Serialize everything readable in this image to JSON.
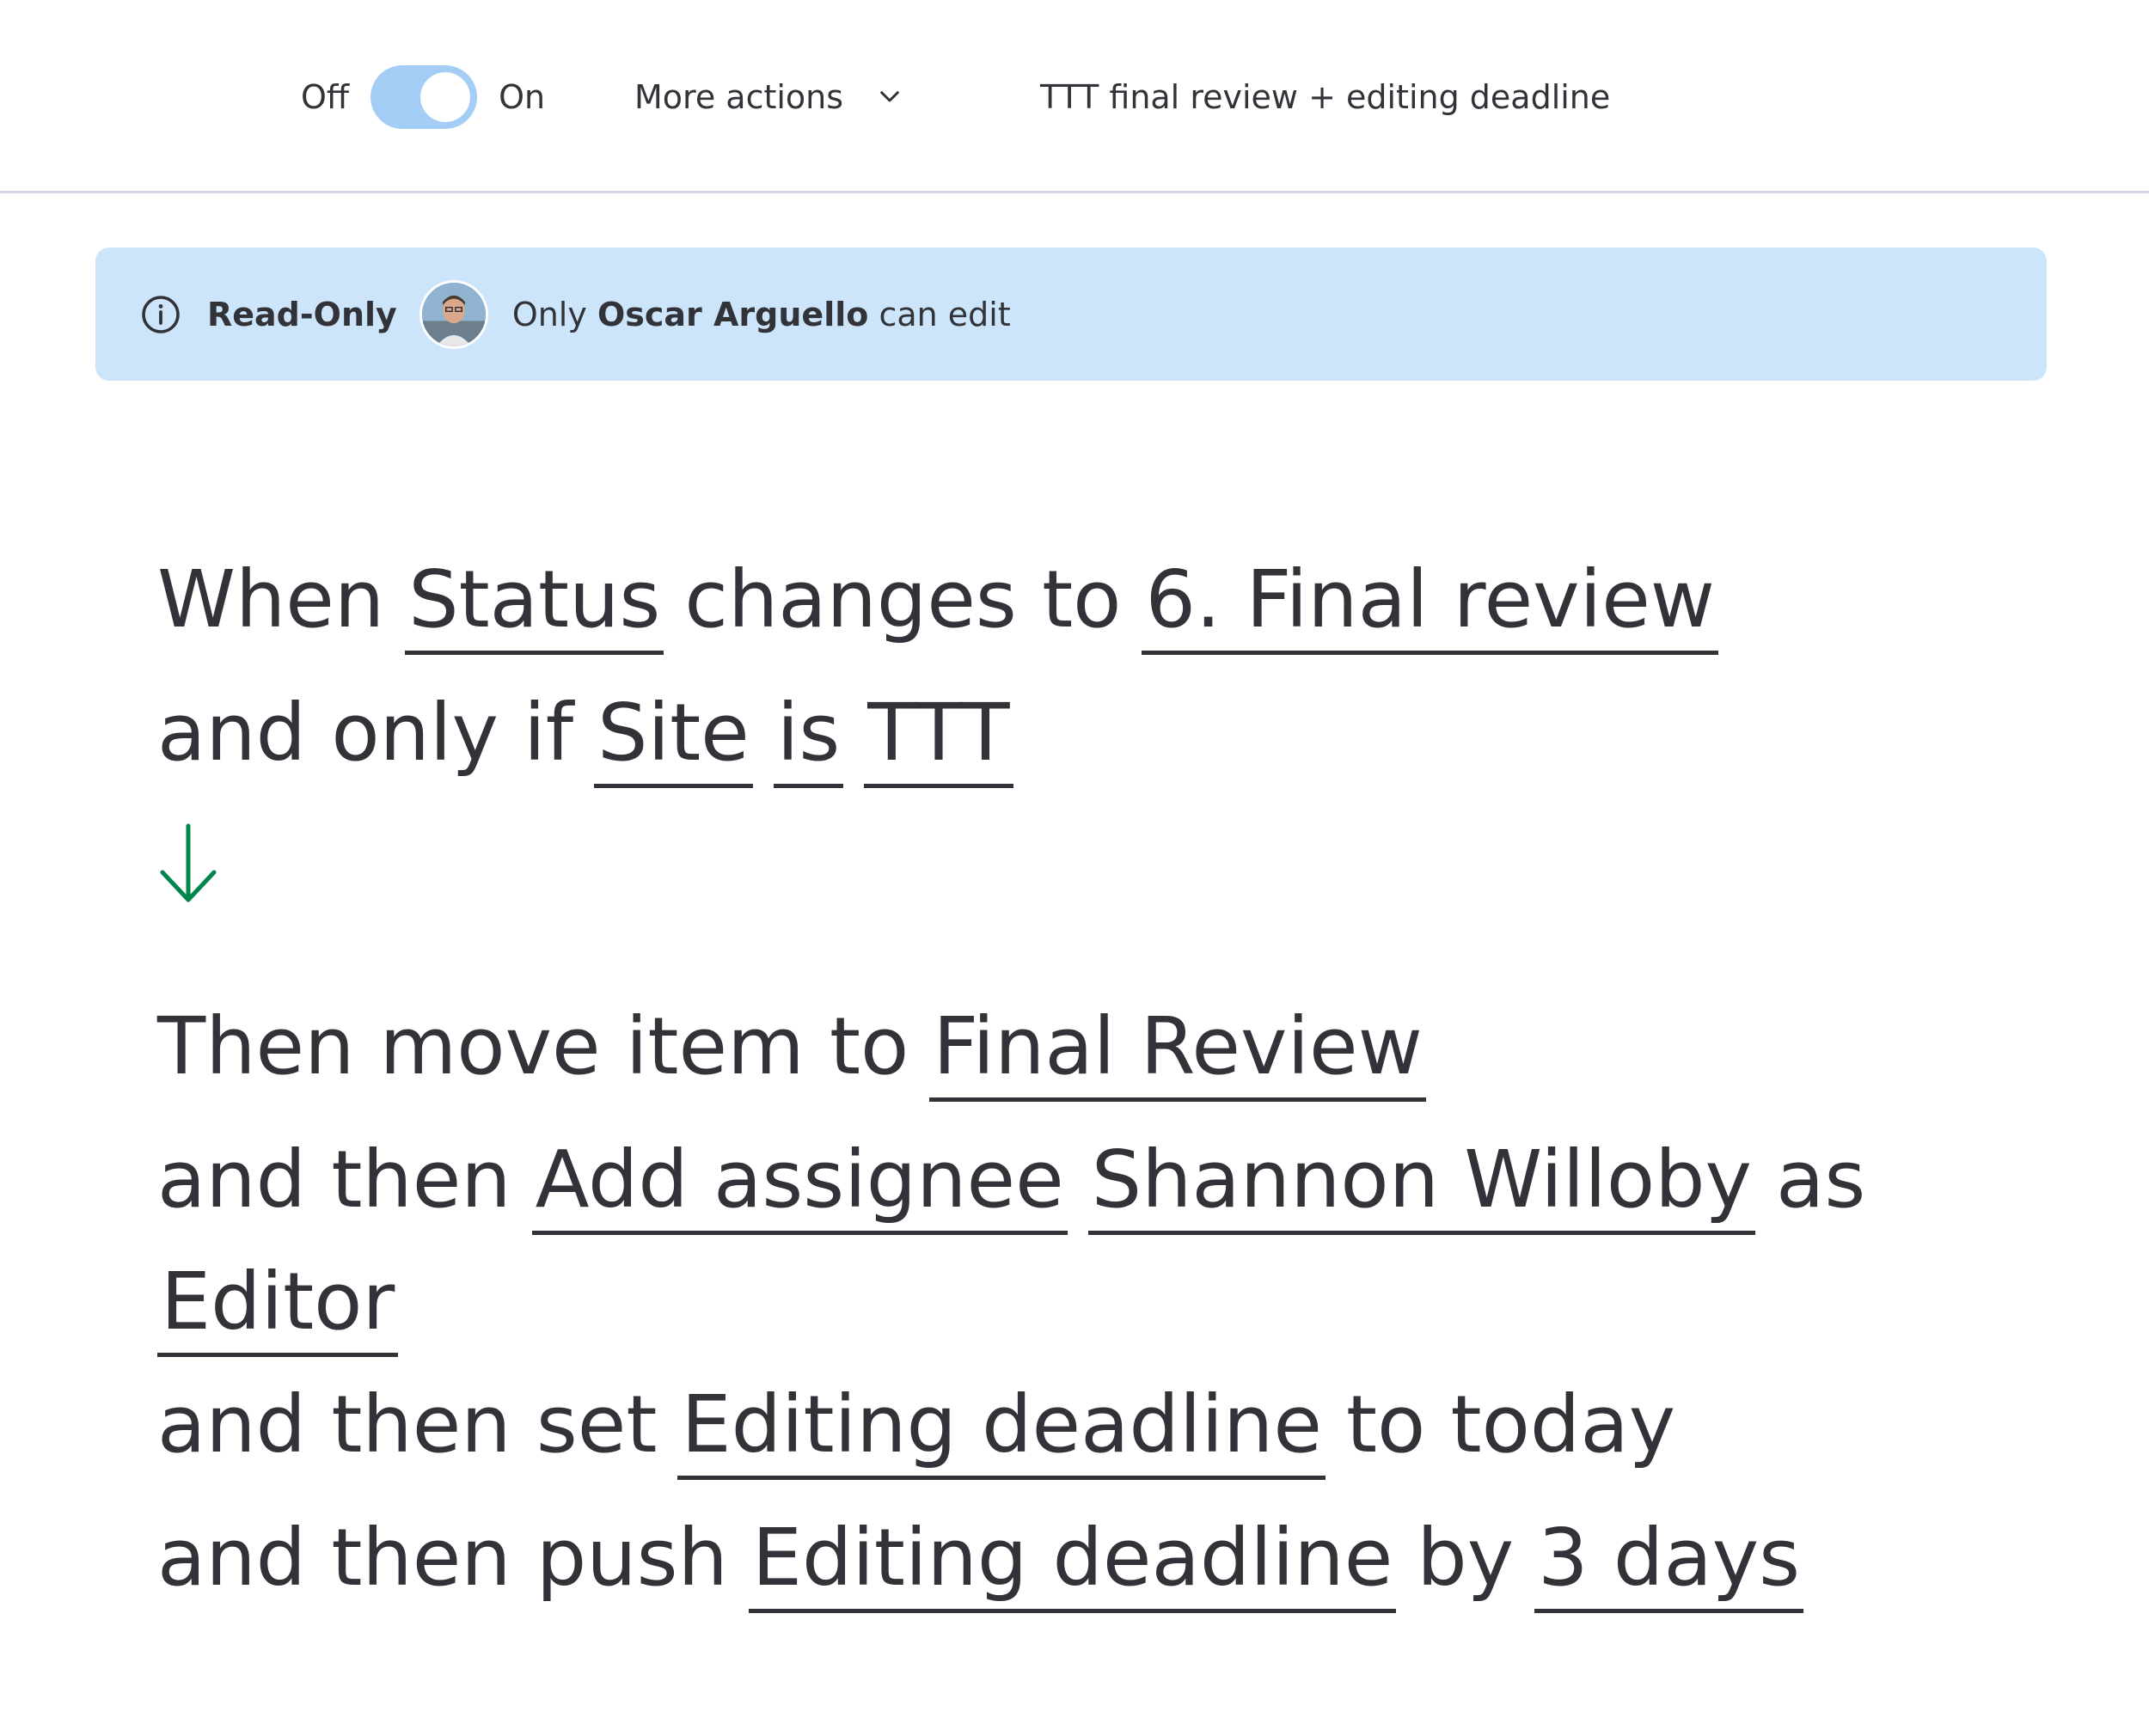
{
  "toolbar": {
    "off_label": "Off",
    "on_label": "On",
    "toggle_state": "on",
    "more_actions_label": "More actions",
    "automation_title": "TTT final review + editing deadline"
  },
  "banner": {
    "readonly_label": "Read-Only",
    "prefix": "Only",
    "owner_name": "Oscar Arguello",
    "suffix": "can edit"
  },
  "recipe": {
    "trigger": {
      "w1": "When",
      "column": "Status",
      "w2": "changes to",
      "value": "6. Final review"
    },
    "condition": {
      "w1": "and only if",
      "column": "Site",
      "operator": "is",
      "value": "TTT"
    },
    "action1": {
      "w1": "Then move item to",
      "group": "Final Review"
    },
    "action2": {
      "w1": "and then",
      "action": "Add assignee",
      "person": "Shannon Willoby",
      "w2": "as",
      "role": "Editor"
    },
    "action3": {
      "w1": "and then set",
      "column": "Editing deadline",
      "w2": "to today"
    },
    "action4": {
      "w1": "and then push",
      "column": "Editing deadline",
      "w2": "by",
      "amount": "3 days"
    }
  },
  "colors": {
    "accent_arrow": "#00854d",
    "banner_bg": "#cce5fb",
    "toggle_bg": "#a4cdf5",
    "text": "#323338"
  },
  "icons": {
    "chevron": "chevron-down-icon",
    "info": "info-icon",
    "arrow": "arrow-down-icon"
  }
}
